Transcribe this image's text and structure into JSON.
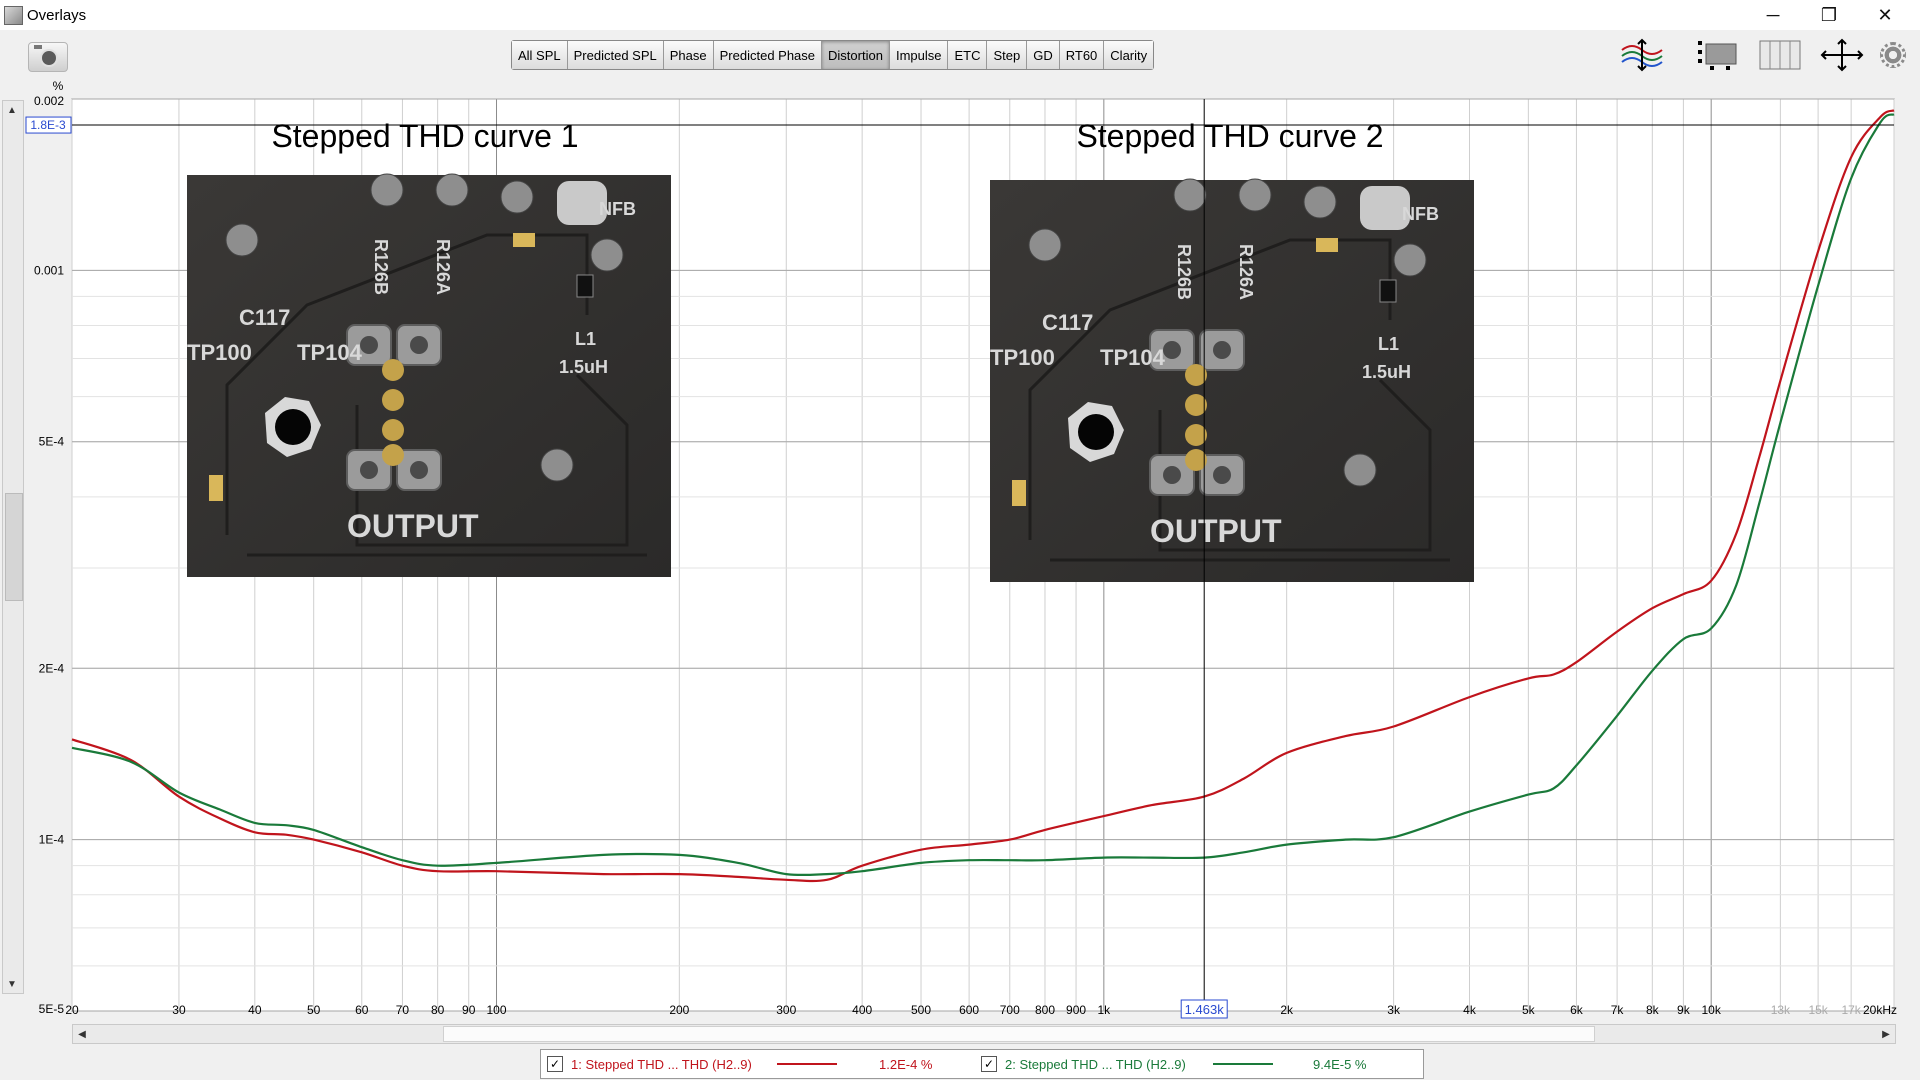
{
  "window": {
    "title": "Overlays",
    "controls": [
      "─",
      "❐",
      "✕"
    ]
  },
  "toolbar": {
    "tabs": [
      {
        "label": "All SPL"
      },
      {
        "label": "Predicted SPL"
      },
      {
        "label": "Phase"
      },
      {
        "label": "Predicted Phase"
      },
      {
        "label": "Distortion",
        "active": true
      },
      {
        "label": "Impulse"
      },
      {
        "label": "ETC"
      },
      {
        "label": "Step"
      },
      {
        "label": "GD"
      },
      {
        "label": "RT60"
      },
      {
        "label": "Clarity"
      }
    ],
    "right_icons": [
      "trace-arrange-icon",
      "controls-panel-icon",
      "columns-icon",
      "fit-arrows-icon",
      "gear-icon"
    ]
  },
  "plot": {
    "y_unit": "%",
    "cursor_y_readout": "1.8E-3",
    "cursor_x_readout": "1.463k",
    "y_ticks": [
      {
        "v": 0.002,
        "label": "0.002"
      },
      {
        "v": 0.001,
        "label": "0.001"
      },
      {
        "v": 0.0005,
        "label": "5E-4"
      },
      {
        "v": 0.0002,
        "label": "2E-4"
      },
      {
        "v": 0.0001,
        "label": "1E-4"
      },
      {
        "v": 5e-05,
        "label": "5E-5"
      }
    ],
    "x_ticks": [
      {
        "f": 20,
        "label": "20"
      },
      {
        "f": 30,
        "label": "30"
      },
      {
        "f": 40,
        "label": "40"
      },
      {
        "f": 50,
        "label": "50"
      },
      {
        "f": 60,
        "label": "60"
      },
      {
        "f": 70,
        "label": "70"
      },
      {
        "f": 80,
        "label": "80"
      },
      {
        "f": 90,
        "label": "90"
      },
      {
        "f": 100,
        "label": "100"
      },
      {
        "f": 200,
        "label": "200"
      },
      {
        "f": 300,
        "label": "300"
      },
      {
        "f": 400,
        "label": "400"
      },
      {
        "f": 500,
        "label": "500"
      },
      {
        "f": 600,
        "label": "600"
      },
      {
        "f": 700,
        "label": "700"
      },
      {
        "f": 800,
        "label": "800"
      },
      {
        "f": 900,
        "label": "900"
      },
      {
        "f": 1000,
        "label": "1k"
      },
      {
        "f": 2000,
        "label": "2k"
      },
      {
        "f": 3000,
        "label": "3k"
      },
      {
        "f": 4000,
        "label": "4k"
      },
      {
        "f": 5000,
        "label": "5k"
      },
      {
        "f": 6000,
        "label": "6k"
      },
      {
        "f": 7000,
        "label": "7k"
      },
      {
        "f": 8000,
        "label": "8k"
      },
      {
        "f": 9000,
        "label": "9k"
      },
      {
        "f": 10000,
        "label": "10k"
      },
      {
        "f": 13000,
        "label": "13k",
        "dim": true
      },
      {
        "f": 15000,
        "label": "15k",
        "dim": true
      },
      {
        "f": 17000,
        "label": "17k",
        "dim": true
      },
      {
        "f": 20000,
        "label": "20kHz"
      }
    ],
    "annotations": [
      {
        "text": "Stepped THD curve 1"
      },
      {
        "text": "Stepped THD curve 2"
      }
    ],
    "board_labels": {
      "c117": "C117",
      "tp100": "TP100",
      "tp104": "TP104",
      "r126b": "R126B",
      "r126a": "R126A",
      "l1": "L1",
      "l1_value": "1.5uH",
      "nfb": "NFB",
      "output": "OUTPUT"
    },
    "colors": {
      "curve1": "#c0141c",
      "curve2": "#1a7a3a",
      "grid": "#c8c8c8",
      "background": "#ffffff"
    }
  },
  "chart_data": {
    "type": "line",
    "x_scale": "log",
    "y_scale": "log",
    "xlim": [
      20,
      20000
    ],
    "ylim": [
      5e-05,
      0.002
    ],
    "ylabel": "%",
    "grid": true,
    "series": [
      {
        "name": "1: Stepped THD ... THD (H2..9)",
        "color": "#c0141c",
        "x": [
          20,
          25,
          30,
          35,
          40,
          45,
          50,
          60,
          70,
          80,
          100,
          150,
          200,
          250,
          300,
          350,
          400,
          500,
          600,
          700,
          800,
          1000,
          1200,
          1463,
          1700,
          2000,
          2500,
          3000,
          4000,
          5000,
          5500,
          6000,
          7000,
          8000,
          9000,
          10000,
          11000,
          12000,
          13000,
          15000,
          17000,
          19000,
          20000
        ],
        "y": [
          0.00015,
          0.000138,
          0.000119,
          0.000109,
          0.000103,
          0.000102,
          0.0001,
          9.5e-05,
          9e-05,
          8.8e-05,
          8.8e-05,
          8.7e-05,
          8.7e-05,
          8.6e-05,
          8.5e-05,
          8.5e-05,
          9e-05,
          9.6e-05,
          9.8e-05,
          0.0001,
          0.000104,
          0.00011,
          0.000115,
          0.000119,
          0.000128,
          0.000142,
          0.000152,
          0.000158,
          0.000178,
          0.000192,
          0.000195,
          0.000205,
          0.000232,
          0.000255,
          0.00027,
          0.000285,
          0.000345,
          0.00047,
          0.00064,
          0.00108,
          0.00158,
          0.00186,
          0.00191
        ]
      },
      {
        "name": "2: Stepped THD ... THD (H2..9)",
        "color": "#1a7a3a",
        "x": [
          20,
          25,
          30,
          35,
          40,
          45,
          50,
          60,
          70,
          80,
          100,
          150,
          200,
          250,
          300,
          350,
          400,
          500,
          600,
          700,
          800,
          1000,
          1200,
          1463,
          1700,
          2000,
          2500,
          3000,
          4000,
          5000,
          5500,
          6000,
          7000,
          8000,
          9000,
          10000,
          11000,
          12000,
          13000,
          15000,
          17000,
          19000,
          20000
        ],
        "y": [
          0.000145,
          0.000137,
          0.000121,
          0.000113,
          0.000107,
          0.000106,
          0.000104,
          9.7e-05,
          9.2e-05,
          9e-05,
          9.1e-05,
          9.4e-05,
          9.4e-05,
          9.1e-05,
          8.7e-05,
          8.7e-05,
          8.8e-05,
          9.1e-05,
          9.2e-05,
          9.2e-05,
          9.2e-05,
          9.3e-05,
          9.3e-05,
          9.3e-05,
          9.5e-05,
          9.8e-05,
          0.0001,
          0.000101,
          0.000112,
          0.00012,
          0.000123,
          0.000135,
          0.000165,
          0.000198,
          0.000225,
          0.000235,
          0.00028,
          0.00039,
          0.00054,
          0.00094,
          0.00145,
          0.00182,
          0.00188
        ]
      }
    ]
  },
  "legend": {
    "items": [
      {
        "checked": "✓",
        "label": "1: Stepped THD ... THD (H2..9)",
        "value": "1.2E-4 %",
        "color": "#c0141c"
      },
      {
        "checked": "✓",
        "label": "2: Stepped THD ... THD (H2..9)",
        "value": "9.4E-5 %",
        "color": "#1a7a3a"
      }
    ]
  }
}
